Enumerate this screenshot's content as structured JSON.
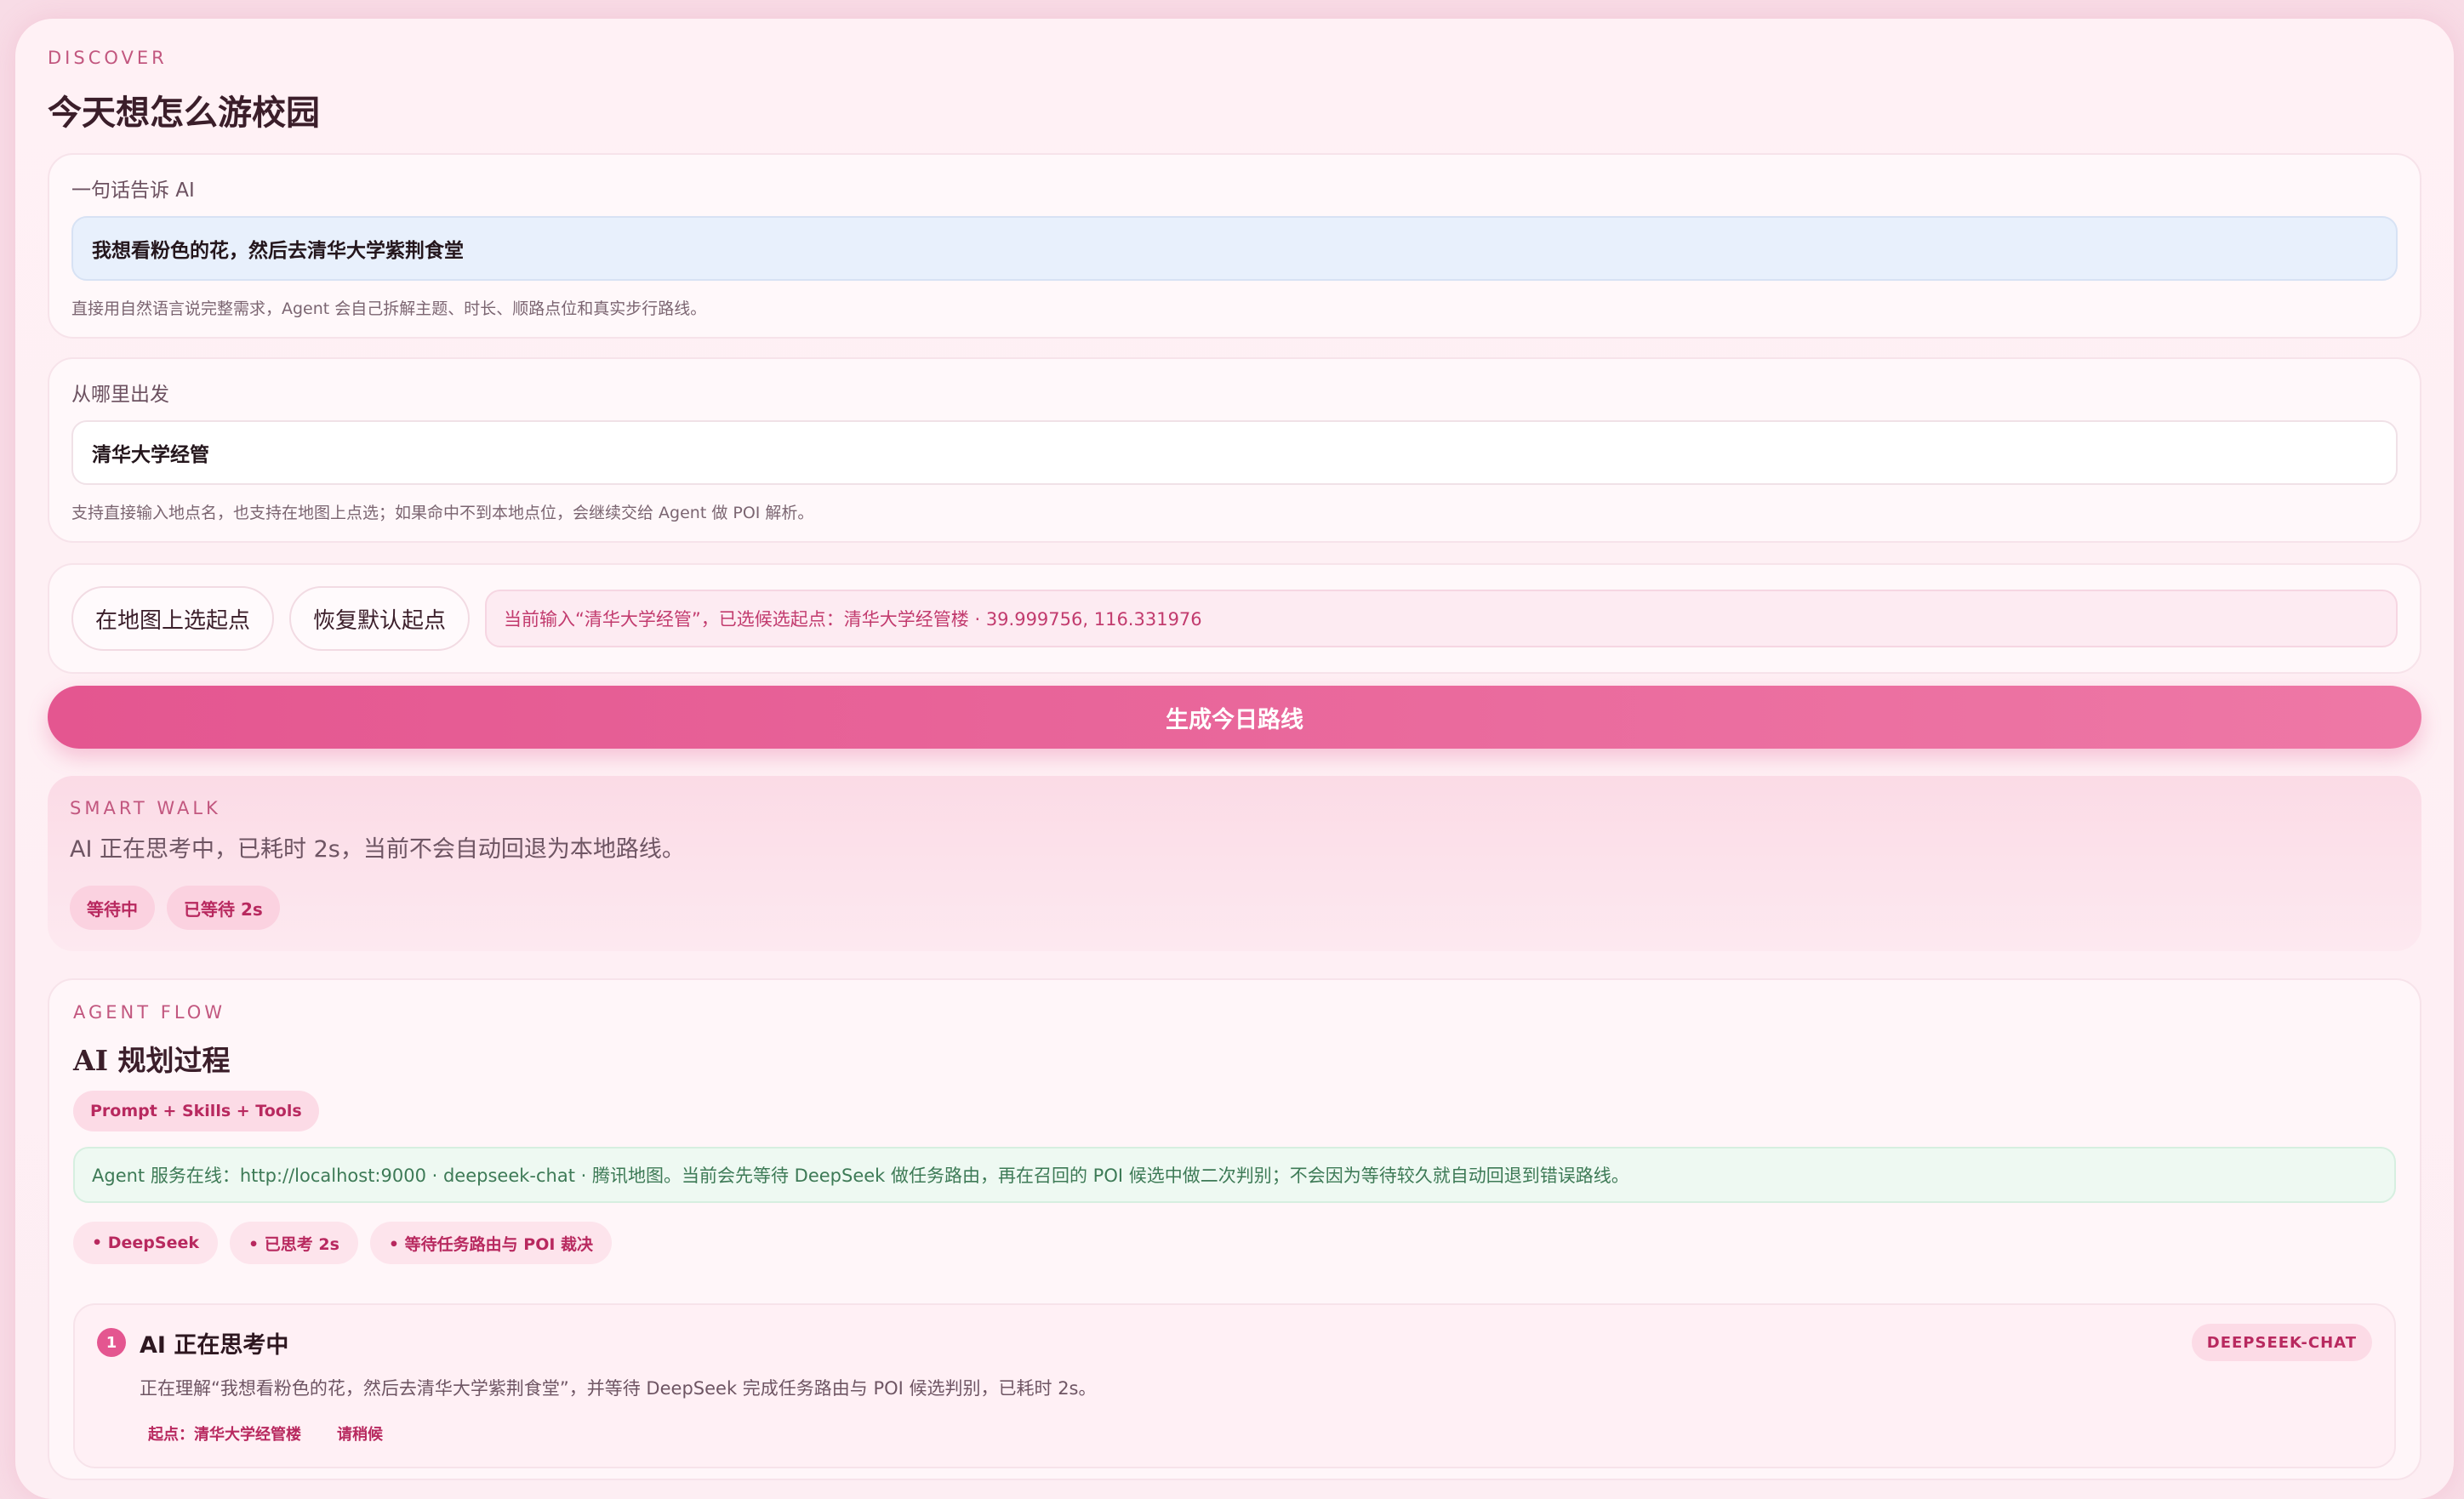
{
  "header": {
    "eyebrow": "DISCOVER",
    "title": "今天想怎么游校园"
  },
  "prompt_field": {
    "label": "一句话告诉 AI",
    "value": "我想看粉色的花，然后去清华大学紫荆食堂",
    "hint": "直接用自然语言说完整需求，Agent 会自己拆解主题、时长、顺路点位和真实步行路线。"
  },
  "origin_field": {
    "label": "从哪里出发",
    "value": "清华大学经管",
    "hint": "支持直接输入地点名，也支持在地图上点选；如果命中不到本地点位，会继续交给 Agent 做 POI 解析。"
  },
  "origin_actions": {
    "pick_on_map": "在地图上选起点",
    "reset_default": "恢复默认起点",
    "status": "当前输入“清华大学经管”，已选候选起点：清华大学经管楼 · 39.999756, 116.331976"
  },
  "generate_button": "生成今日路线",
  "smart_walk": {
    "eyebrow": "SMART WALK",
    "message": "AI 正在思考中，已耗时 2s，当前不会自动回退为本地路线。",
    "tags": [
      "等待中",
      "已等待 2s"
    ]
  },
  "agent_flow": {
    "eyebrow": "AGENT FLOW",
    "title": "AI 规划过程",
    "chip": "Prompt + Skills + Tools",
    "service_status": "Agent 服务在线：http://localhost:9000 · deepseek-chat · 腾讯地图。当前会先等待 DeepSeek 做任务路由，再在召回的 POI 候选中做二次判别；不会因为等待较久就自动回退到错误路线。",
    "tags": [
      "• DeepSeek",
      "• 已思考 2s",
      "• 等待任务路由与 POI 裁决"
    ],
    "step": {
      "number": "1",
      "title": "AI 正在思考中",
      "badge": "DEEPSEEK-CHAT",
      "description": "正在理解“我想看粉色的花，然后去清华大学紫荆食堂”，并等待 DeepSeek 完成任务路由与 POI 候选判别，已耗时 2s。",
      "meta": [
        "起点：清华大学经管楼",
        "请稍候"
      ]
    }
  },
  "colors": {
    "accent": "#e45690",
    "accent_light": "#ee78a6",
    "tag_text": "#b8295f",
    "success_text": "#3d7a56"
  }
}
